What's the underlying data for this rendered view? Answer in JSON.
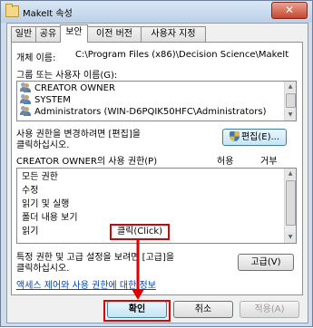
{
  "window": {
    "title": "MakeIt 속성",
    "close_glyph": "✕"
  },
  "tabs": [
    {
      "label": "일반",
      "active": false
    },
    {
      "label": "공유",
      "active": false
    },
    {
      "label": "보안",
      "active": true
    },
    {
      "label": "이전 버전",
      "active": false
    },
    {
      "label": "사용자 지정",
      "active": false
    }
  ],
  "security": {
    "object_name_label": "개체 이름:",
    "object_name_value": "C:\\Program Files (x86)\\Decision Science\\MakeIt",
    "group_label": "그룹 또는 사용자 이름(G):",
    "users": [
      {
        "name": "CREATOR OWNER",
        "icon": "user-group-icon"
      },
      {
        "name": "SYSTEM",
        "icon": "user-group-icon"
      },
      {
        "name": "Administrators (WIN-D6PQIK50HFC\\Administrators)",
        "icon": "user-group-icon"
      }
    ],
    "change_text_line1": "사용 권한을 변경하려면 [편집]을",
    "change_text_line2": "클릭하십시오.",
    "edit_button": "편집(E)...",
    "perm_title": "CREATOR OWNER의 사용 권한(P)",
    "col_allow": "허용",
    "col_deny": "거부",
    "permissions": [
      "모든 권한",
      "수정",
      "읽기 및 실행",
      "폴더 내용 보기",
      "읽기"
    ],
    "advanced_text_line1": "특정 권한 및 고급 설정을 보려면 [고급]을",
    "advanced_text_line2": "클릭하십시오.",
    "advanced_button": "고급(V)",
    "link_text": "액세스 제어와 사용 권한에 대한 정보"
  },
  "buttons": {
    "ok": "확인",
    "cancel": "취소",
    "apply": "적용(A)"
  },
  "annotation": {
    "callout_text": "클릭(Click)",
    "color": "#e00000"
  }
}
